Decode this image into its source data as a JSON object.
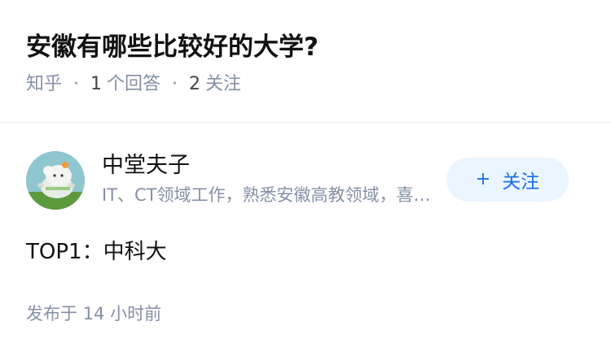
{
  "question": {
    "title": "安徽有哪些比较好的大学?",
    "source": "知乎",
    "separator": "·",
    "answer_count": "1",
    "answer_label": "个回答",
    "follower_count": "2",
    "follower_label": "关注"
  },
  "answer": {
    "author": {
      "name": "中堂夫子",
      "headline": "IT、CT领域工作，熟悉安徽高教领域，喜欢数据分析",
      "follow_label": "关注",
      "follow_icon": "plus-icon"
    },
    "content": "TOP1：中科大",
    "published_label": "发布于",
    "published_time": "14 小时前"
  },
  "colors": {
    "title": "#121212",
    "meta": "#8590a6",
    "follow_button_bg": "#ebf5ff",
    "follow_button_text": "#1a6ee6",
    "divider": "#ebebeb"
  }
}
